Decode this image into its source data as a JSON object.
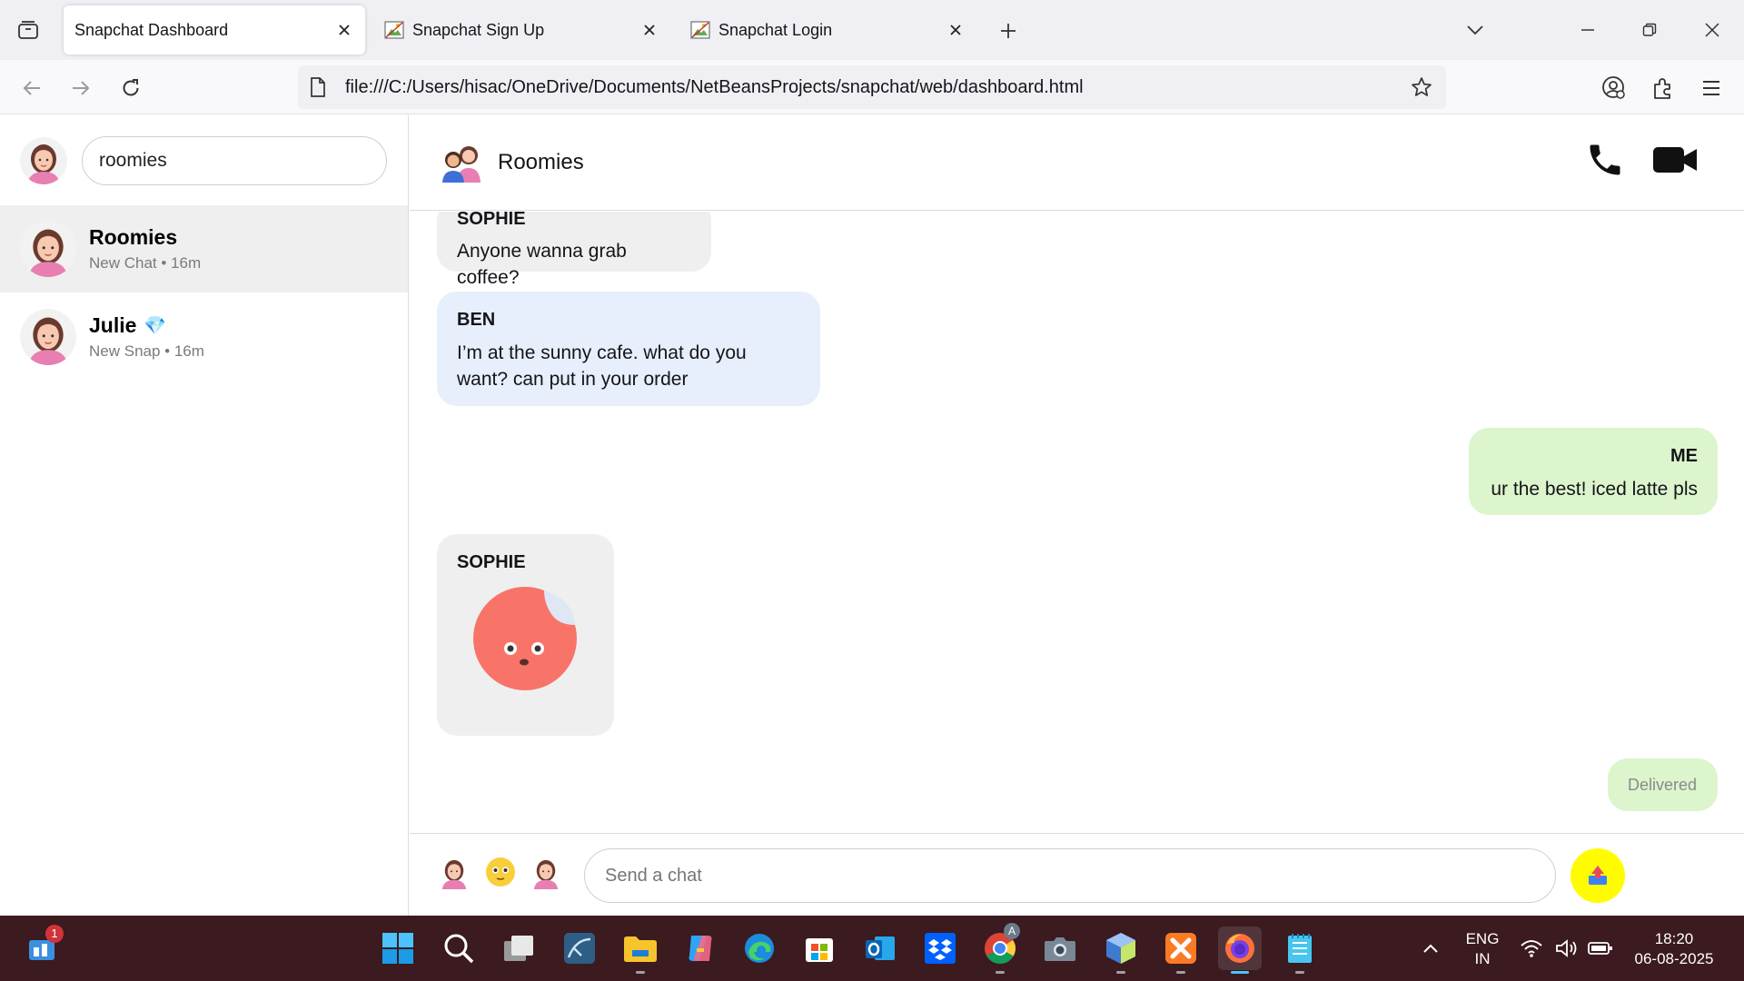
{
  "browser": {
    "tabs": [
      {
        "title": "Snapchat Dashboard",
        "active": true
      },
      {
        "title": "Snapchat Sign Up",
        "active": false
      },
      {
        "title": "Snapchat Login",
        "active": false
      }
    ],
    "url": "file:///C:/Users/hisac/OneDrive/Documents/NetBeansProjects/snapchat/web/dashboard.html"
  },
  "sidebar": {
    "search_value": "roomies",
    "chats": [
      {
        "name": "Roomies",
        "subtitle": "New Chat • 16m",
        "selected": true
      },
      {
        "name": "Julie",
        "subtitle": "New Snap • 16m",
        "badge": "💎",
        "selected": false
      }
    ]
  },
  "chat": {
    "title": "Roomies",
    "messages": [
      {
        "sender": "SOPHIE",
        "text": "Anyone wanna grab coffee?"
      },
      {
        "sender": "BEN",
        "text": "I’m at the sunny cafe. what do you want? can put in your order"
      },
      {
        "sender": "ME",
        "text": "ur the best! iced latte pls"
      },
      {
        "sender": "SOPHIE",
        "sticker": "red-blob-sticker"
      }
    ],
    "status": "Delivered",
    "input_placeholder": "Send a chat"
  },
  "taskbar": {
    "notification_count": "1",
    "chrome_badge": "A",
    "language_line1": "ENG",
    "language_line2": "IN",
    "time": "18:20",
    "date": "06-08-2025"
  },
  "colors": {
    "snap_yellow": "#fffc00",
    "me_bubble": "#dcf5cc",
    "other_bubble_blue": "#e6effb",
    "other_bubble_gray": "#efefef",
    "taskbar_bg": "#3b1a20"
  }
}
